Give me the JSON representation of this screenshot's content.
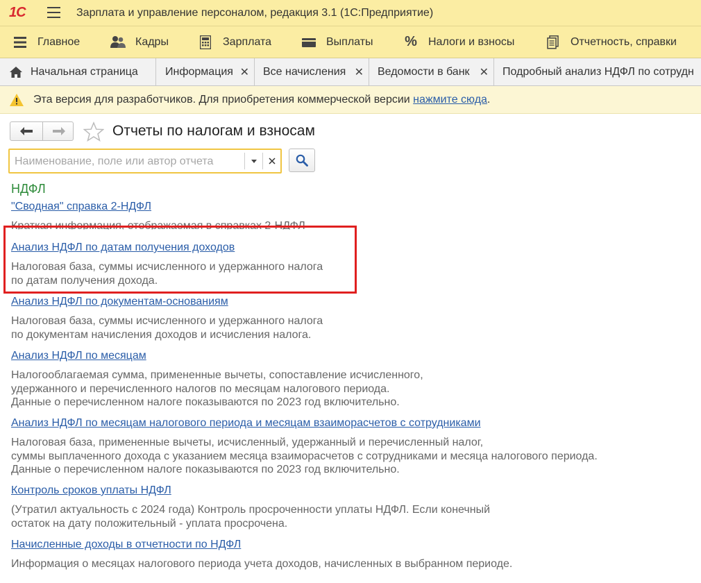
{
  "app": {
    "logo": "1С",
    "title": "Зарплата и управление персоналом, редакция 3.1  (1С:Предприятие)"
  },
  "sections": [
    {
      "label": "Главное",
      "icon": "menu-lines-icon"
    },
    {
      "label": "Кадры",
      "icon": "people-icon"
    },
    {
      "label": "Зарплата",
      "icon": "calculator-icon"
    },
    {
      "label": "Выплаты",
      "icon": "wallet-icon"
    },
    {
      "label": "Налоги и взносы",
      "icon": "percent-icon"
    },
    {
      "label": "Отчетность, справки",
      "icon": "documents-icon"
    }
  ],
  "tabs": [
    {
      "label": "Начальная страница",
      "icon": "home-icon"
    },
    {
      "label": "Информация",
      "close": "✕"
    },
    {
      "label": "Все начисления",
      "close": "✕"
    },
    {
      "label": "Ведомости в банк",
      "close": "✕"
    },
    {
      "label": "Подробный анализ НДФЛ по сотрудн"
    }
  ],
  "banner": {
    "text": "Эта версия для разработчиков. Для приобретения коммерческой версии ",
    "link": "нажмите сюда",
    "tail": "."
  },
  "form": {
    "title": "Отчеты по налогам и взносам",
    "search_placeholder": "Наименование, поле или автор отчета",
    "search_value": ""
  },
  "group": "НДФЛ",
  "reports": [
    {
      "title": "\"Сводная\" справка 2-НДФЛ",
      "desc": "Краткая информация, отображаемая в справках 2-НДФЛ"
    },
    {
      "title": "Анализ НДФЛ по датам получения доходов",
      "desc": "Налоговая база, суммы исчисленного и удержанного налога\nпо датам получения дохода."
    },
    {
      "title": "Анализ НДФЛ по документам-основаниям",
      "desc": "Налоговая база, суммы исчисленного и удержанного налога\nпо документам начисления доходов и исчисления налога."
    },
    {
      "title": "Анализ НДФЛ по месяцам",
      "desc": "Налогооблагаемая сумма, примененные вычеты, сопоставление исчисленного,\nудержанного и перечисленного налогов по месяцам налогового периода.\nДанные о перечисленном налоге показываются по 2023 год включительно."
    },
    {
      "title": "Анализ НДФЛ по месяцам налогового периода и месяцам взаиморасчетов с сотрудниками",
      "desc": "Налоговая база, примененные вычеты, исчисленный, удержанный и перечисленный налог,\nсуммы выплаченного дохода с указанием месяца взаиморасчетов с сотрудниками и месяца налогового периода.\nДанные о перечисленном налоге показываются по 2023 год включительно."
    },
    {
      "title": "Контроль сроков уплаты НДФЛ",
      "desc": "(Утратил актуальность с 2024 года) Контроль просроченности уплаты НДФЛ. Если конечный\nостаток на дату положительный - уплата просрочена."
    },
    {
      "title": "Начисленные доходы в отчетности по НДФЛ",
      "desc": "Информация о месяцах налогового периода учета доходов, начисленных в выбранном периоде."
    }
  ],
  "colors": {
    "title_bar": "#fbeda3",
    "link": "#2a5da8",
    "group": "#2e8b3a",
    "highlight": "#e02020"
  }
}
